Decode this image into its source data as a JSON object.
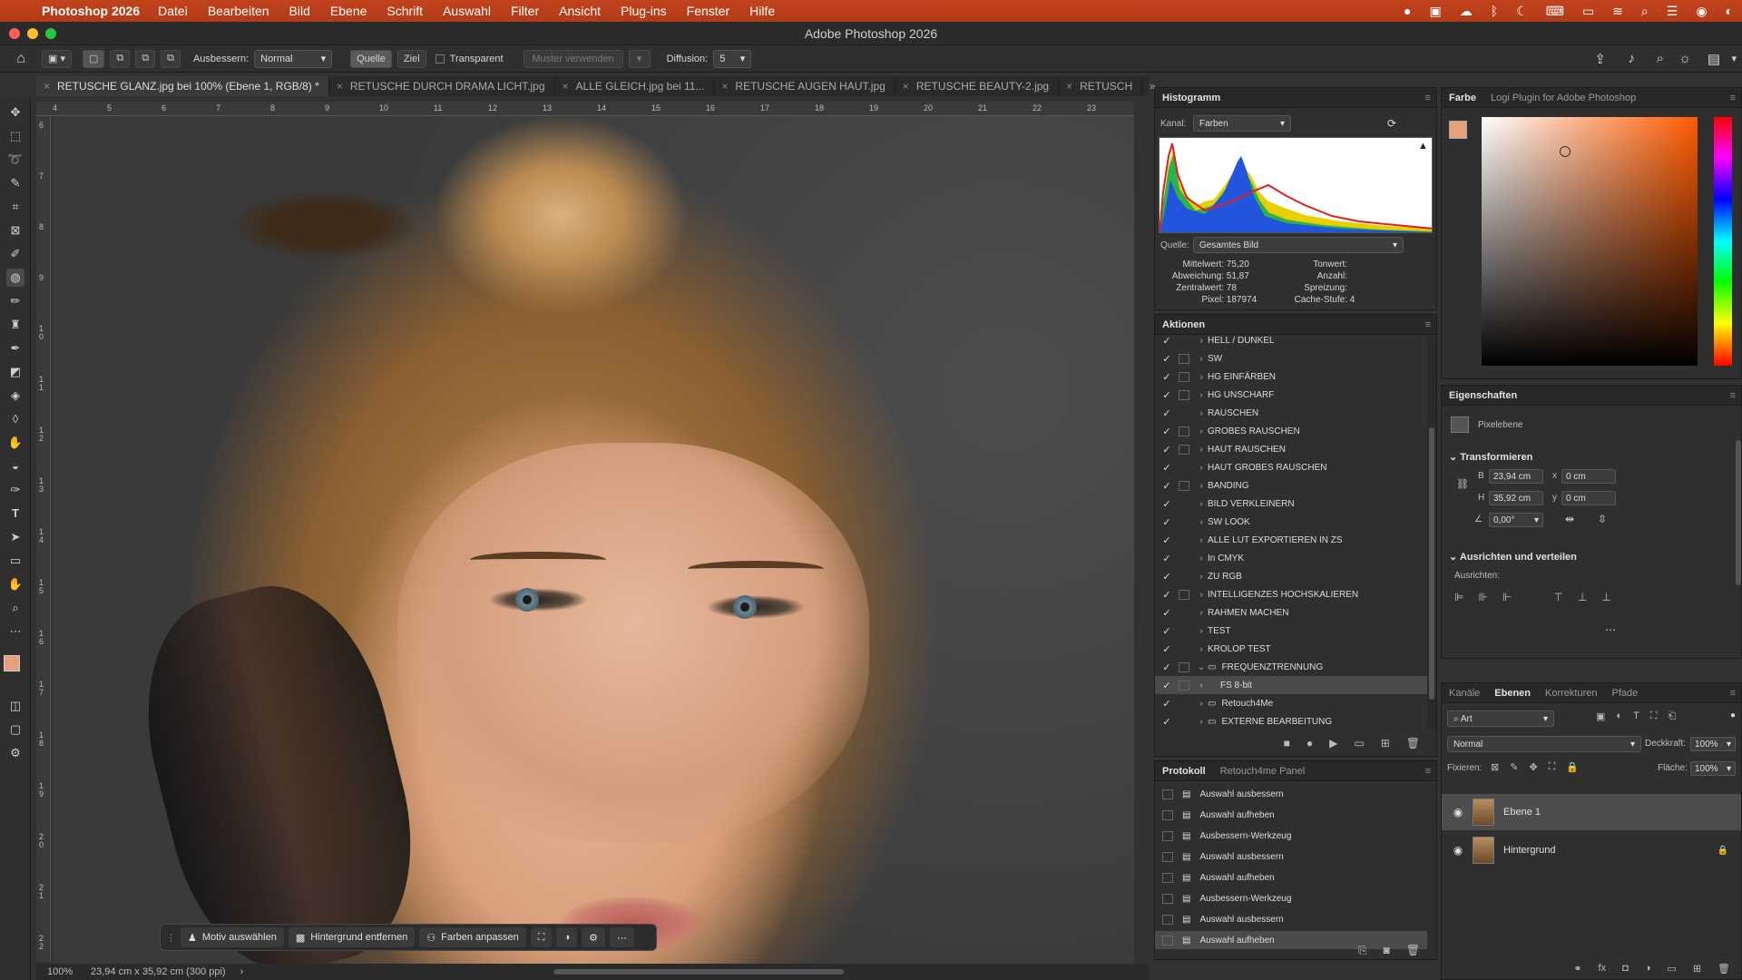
{
  "menubar": {
    "app_name": "Photoshop 2026",
    "items": [
      "Datei",
      "Bearbeiten",
      "Bild",
      "Ebene",
      "Schrift",
      "Auswahl",
      "Filter",
      "Ansicht",
      "Plug-ins",
      "Fenster",
      "Hilfe"
    ]
  },
  "window": {
    "title": "Adobe Photoshop 2026"
  },
  "options": {
    "ausbessern_label": "Ausbessern:",
    "mode_value": "Normal",
    "quelle": "Quelle",
    "ziel": "Ziel",
    "transparent": "Transparent",
    "muster": "Muster verwenden",
    "diffusion_label": "Diffusion:",
    "diffusion_value": "5"
  },
  "tabs": [
    "RETUSCHE GLANZ.jpg bei 100% (Ebene 1, RGB/8) *",
    "RETUSCHE DURCH DRAMA LICHT.jpg",
    "ALLE GLEICH.jpg bei 11...",
    "RETUSCHE AUGEN HAUT.jpg",
    "RETUSCHE BEAUTY-2.jpg",
    "RETUSCH"
  ],
  "ruler": {
    "h": [
      "4",
      "5",
      "6",
      "7",
      "8",
      "9",
      "10",
      "11",
      "12",
      "13",
      "14",
      "15",
      "16",
      "17",
      "18",
      "19",
      "20",
      "21",
      "22",
      "23"
    ],
    "v": [
      "6",
      "7",
      "8",
      "9",
      "1 0",
      "1 1",
      "1 2",
      "1 3",
      "1 4",
      "1 5",
      "1 6",
      "1 7",
      "1 8",
      "1 9",
      "2 0",
      "2 1",
      "2 2"
    ]
  },
  "status": {
    "zoom": "100%",
    "info": "23,94 cm x 35,92 cm (300 ppi)"
  },
  "taskbar": {
    "motiv": "Motiv auswählen",
    "hintergrund": "Hintergrund entfernen",
    "farben": "Farben anpassen"
  },
  "histogram": {
    "title": "Histogramm",
    "kanal_label": "Kanal:",
    "kanal_value": "Farben",
    "quelle_label": "Quelle:",
    "quelle_value": "Gesamtes Bild",
    "stats_left": [
      {
        "k": "Mittelwert:",
        "v": "75,20"
      },
      {
        "k": "Abweichung:",
        "v": "51,87"
      },
      {
        "k": "Zentralwert:",
        "v": "78"
      },
      {
        "k": "Pixel:",
        "v": "187974"
      }
    ],
    "stats_right": [
      {
        "k": "Tonwert:",
        "v": ""
      },
      {
        "k": "Anzahl:",
        "v": ""
      },
      {
        "k": "Spreizung:",
        "v": ""
      },
      {
        "k": "Cache-Stufe:",
        "v": "4"
      }
    ]
  },
  "actions": {
    "title": "Aktionen",
    "items": [
      "HELL / DUNKEL",
      "SW",
      "HG EINFÄRBEN",
      "HG UNSCHARF",
      "RAUSCHEN",
      "GROBES RAUSCHEN",
      "HAUT RAUSCHEN",
      "HAUT GROBES RAUSCHEN",
      "BANDING",
      "BILD VERKLEINERN",
      "SW LOOK",
      "ALLE LUT EXPORTIEREN IN ZS",
      "In CMYK",
      "ZU RGB",
      "INTELLIGENZES HOCHSKALIEREN",
      "RAHMEN MACHEN",
      "TEST",
      "KROLOP TEST",
      "FREQUENZTRENNUNG",
      "FS 8-bit",
      "Retouch4Me",
      "EXTERNE BEARBEITUNG"
    ]
  },
  "history": {
    "tab1": "Protokoll",
    "tab2": "Retouch4me Panel",
    "items": [
      "Auswahl ausbessern",
      "Auswahl aufheben",
      "Ausbessern-Werkzeug",
      "Auswahl ausbessern",
      "Auswahl aufheben",
      "Ausbessern-Werkzeug",
      "Auswahl ausbessern",
      "Auswahl aufheben"
    ]
  },
  "color": {
    "tab1": "Farbe",
    "tab2": "Logi Plugin for Adobe Photoshop",
    "foreground": "#e8a07a"
  },
  "properties": {
    "title": "Eigenschaften",
    "type": "Pixelebene",
    "transform": "Transformieren",
    "b_label": "B",
    "b_value": "23,94 cm",
    "h_label": "H",
    "h_value": "35,92 cm",
    "x_label": "x",
    "x_value": "0 cm",
    "y_label": "y",
    "y_value": "0 cm",
    "angle": "0,00°",
    "align_title": "Ausrichten und verteilen",
    "align_label": "Ausrichten:"
  },
  "layers": {
    "tabs": [
      "Kanäle",
      "Ebenen",
      "Korrekturen",
      "Pfade"
    ],
    "filter": "Art",
    "mode": "Normal",
    "opacity_label": "Deckkraft:",
    "opacity_value": "100%",
    "lock_label": "Fixieren:",
    "fill_label": "Fläche:",
    "fill_value": "100%",
    "items": [
      "Ebene 1",
      "Hintergrund"
    ]
  }
}
